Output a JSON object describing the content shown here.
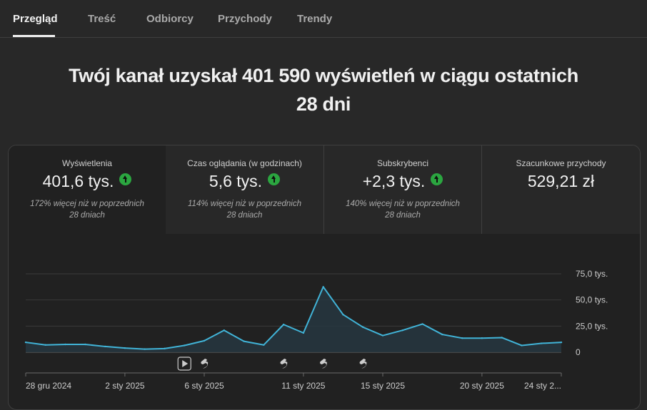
{
  "tabs": [
    {
      "label": "Przegląd",
      "active": true
    },
    {
      "label": "Treść"
    },
    {
      "label": "Odbiorcy"
    },
    {
      "label": "Przychody"
    },
    {
      "label": "Trendy"
    }
  ],
  "headline": {
    "line1": "Twój kanał uzyskał 401 590 wyświetleń w ciągu ostatnich",
    "line2": "28 dni"
  },
  "metrics": [
    {
      "title": "Wyświetlenia",
      "value": "401,6 tys.",
      "trend": "up",
      "note1": "172% więcej niż w poprzednich",
      "note2": "28 dniach"
    },
    {
      "title": "Czas oglądania (w godzinach)",
      "value": "5,6 tys.",
      "trend": "up",
      "note1": "114% więcej niż w poprzednich",
      "note2": "28 dniach"
    },
    {
      "title": "Subskrybenci",
      "value": "+2,3 tys.",
      "trend": "up",
      "note1": "140% więcej niż w poprzednich",
      "note2": "28 dniach"
    },
    {
      "title": "Szacunkowe przychody",
      "value": "529,21 zł"
    }
  ],
  "colors": {
    "accent_line": "#41b4d8",
    "up_badge": "#2ba640"
  },
  "chart_data": {
    "type": "area",
    "ylim": [
      0,
      75000
    ],
    "y_ticks": [
      "75,0 tys.",
      "50,0 tys.",
      "25,0 tys.",
      "0"
    ],
    "x_labels": [
      "28 gru 2024",
      "2 sty 2025",
      "6 sty 2025",
      "11 sty 2025",
      "15 sty 2025",
      "20 sty 2025",
      "24 sty 2..."
    ],
    "series": [
      {
        "values": [
          9500,
          7000,
          7500,
          7500,
          5500,
          4000,
          3000,
          3500,
          6500,
          11000,
          21000,
          10500,
          7000,
          26500,
          18500,
          62500,
          36000,
          24000,
          16000,
          21000,
          27000,
          17000,
          13500,
          13500,
          14000,
          6500,
          8500,
          9500
        ]
      }
    ],
    "markers": [
      {
        "icon": "play-icon",
        "day_index": 8
      },
      {
        "icon": "shorts-icon",
        "day_index": 9
      },
      {
        "icon": "shorts-icon",
        "day_index": 13
      },
      {
        "icon": "shorts-icon",
        "day_index": 15
      },
      {
        "icon": "shorts-icon",
        "day_index": 17
      }
    ]
  }
}
